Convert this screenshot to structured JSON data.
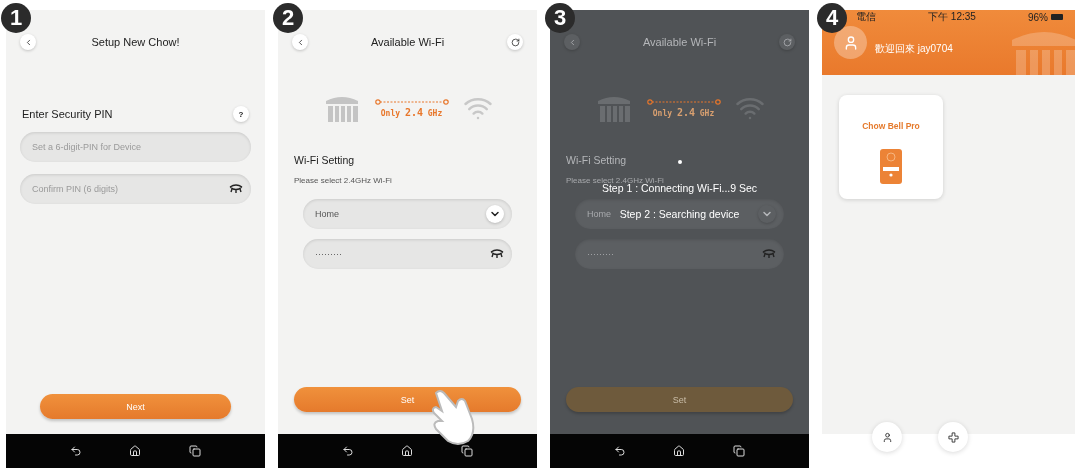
{
  "screens": [
    {
      "kind": "pin",
      "badge": "1",
      "title": "Setup New Chow!",
      "section_title": "Enter Security PIN",
      "help": "?",
      "fields": [
        {
          "kind": "text",
          "placeholder": "Set a 6-digit-PIN for Device"
        },
        {
          "kind": "secret",
          "placeholder": "Confirm PIN (6 digits)"
        }
      ],
      "button": "Next"
    },
    {
      "kind": "wifi",
      "badge": "2",
      "title": "Available Wi-Fi",
      "band": {
        "prefix": "Only",
        "value": "2.4",
        "unit": "GHz"
      },
      "section_title": "Wi-Fi Setting",
      "hint": "Please select 2.4GHz Wi-Fi",
      "network": "Home",
      "password": "·········",
      "button": "Set",
      "pointer": true,
      "dimmed": false
    },
    {
      "kind": "wifi",
      "badge": "3",
      "title": "Available Wi-Fi",
      "band": {
        "prefix": "Only",
        "value": "2.4",
        "unit": "GHz"
      },
      "section_title": "Wi-Fi Setting",
      "hint": "Please select 2.4GHz Wi-Fi",
      "network": "Home",
      "password": "·········",
      "button": "Set",
      "pointer": false,
      "dimmed": true,
      "loading_steps": [
        "Step 1 : Connecting Wi-Fi...9 Sec",
        "Step 2 : Searching device"
      ]
    },
    {
      "kind": "home",
      "badge": "4",
      "status_bar": {
        "carrier": "電信",
        "time": "下午 12:35",
        "battery": "96%"
      },
      "welcome": "歡迎回來 jay0704",
      "devices": [
        {
          "name": "Chow Bell Pro"
        }
      ]
    }
  ]
}
